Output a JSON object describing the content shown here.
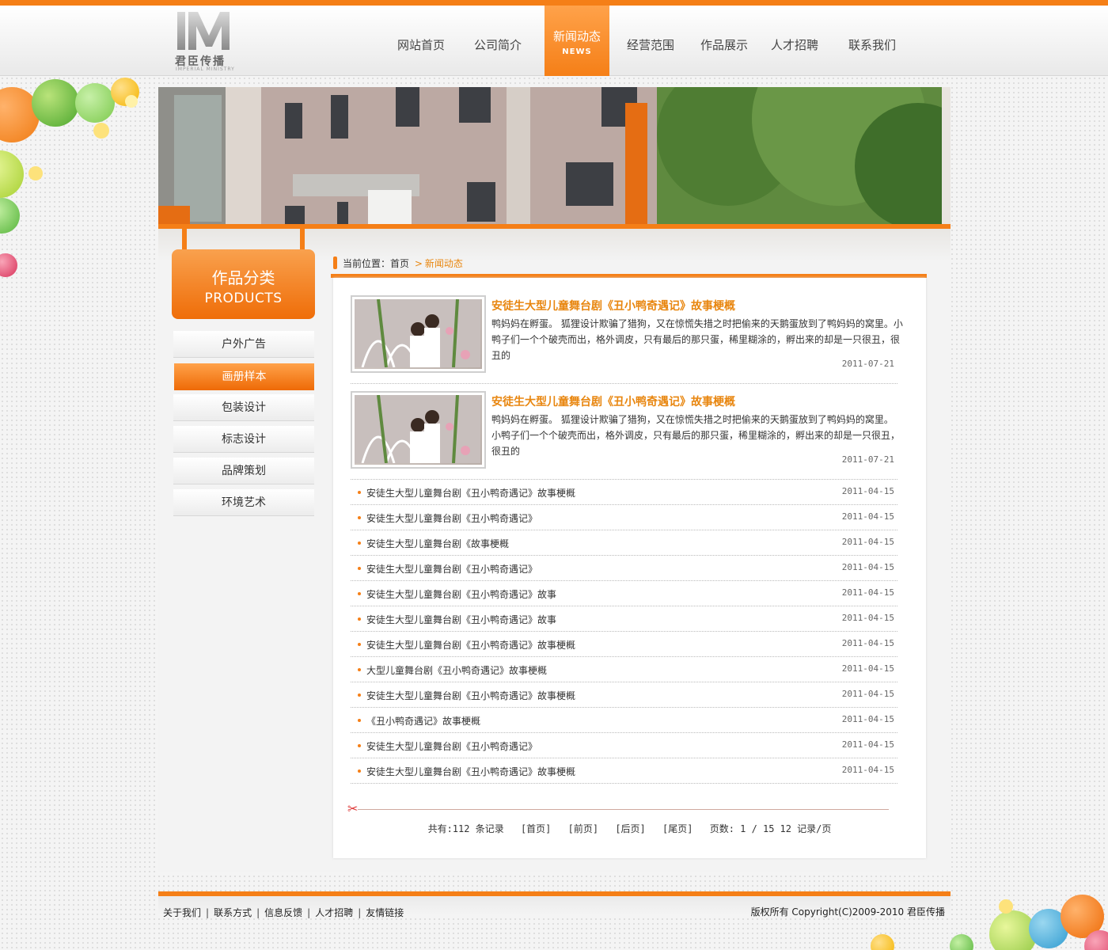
{
  "colors": {
    "accent": "#f57f17",
    "title": "#e8860f",
    "text": "#333333"
  },
  "logo": {
    "monogram": "IM",
    "name": "君臣传播",
    "sub": "IMPERIAL MINISTRY"
  },
  "nav": [
    {
      "label": "网站首页"
    },
    {
      "label": "公司简介"
    },
    {
      "label": "新闻动态",
      "sub": "NEWS",
      "active": true
    },
    {
      "label": "经营范围"
    },
    {
      "label": "作品展示"
    },
    {
      "label": "人才招聘"
    },
    {
      "label": "联系我们"
    }
  ],
  "sidebar": {
    "title": "作品分类",
    "subtitle": "PRODUCTS",
    "items": [
      {
        "label": "户外广告"
      },
      {
        "label": "画册样本",
        "active": true
      },
      {
        "label": "包装设计"
      },
      {
        "label": "标志设计"
      },
      {
        "label": "品牌策划"
      },
      {
        "label": "环境艺术"
      }
    ]
  },
  "breadcrumb": {
    "prefix": "当前位置：",
    "home": "首页",
    "current": "新闻动态"
  },
  "featured": [
    {
      "title": "安徒生大型儿童舞台剧《丑小鸭奇遇记》故事梗概",
      "desc": "鸭妈妈在孵蛋。 狐狸设计欺骗了猎狗，又在惊慌失措之时把偷来的天鹅蛋放到了鸭妈妈的窝里。小鸭子们一个个破壳而出，格外调皮，只有最后的那只蛋，稀里糊涂的，孵出来的却是一只很丑，很丑的",
      "date": "2011-07-21"
    },
    {
      "title": "安徒生大型儿童舞台剧《丑小鸭奇遇记》故事梗概",
      "desc": "鸭妈妈在孵蛋。 狐狸设计欺骗了猎狗，又在惊慌失措之时把偷来的天鹅蛋放到了鸭妈妈的窝里。 小鸭子们一个个破壳而出，格外调皮，只有最后的那只蛋，稀里糊涂的，孵出来的却是一只很丑，很丑的",
      "date": "2011-07-21"
    }
  ],
  "news_list": [
    {
      "title": "安徒生大型儿童舞台剧《丑小鸭奇遇记》故事梗概",
      "date": "2011-04-15"
    },
    {
      "title": "安徒生大型儿童舞台剧《丑小鸭奇遇记》",
      "date": "2011-04-15"
    },
    {
      "title": "安徒生大型儿童舞台剧《故事梗概",
      "date": "2011-04-15"
    },
    {
      "title": "安徒生大型儿童舞台剧《丑小鸭奇遇记》",
      "date": "2011-04-15"
    },
    {
      "title": "安徒生大型儿童舞台剧《丑小鸭奇遇记》故事",
      "date": "2011-04-15"
    },
    {
      "title": "安徒生大型儿童舞台剧《丑小鸭奇遇记》故事",
      "date": "2011-04-15"
    },
    {
      "title": "安徒生大型儿童舞台剧《丑小鸭奇遇记》故事梗概",
      "date": "2011-04-15"
    },
    {
      "title": "大型儿童舞台剧《丑小鸭奇遇记》故事梗概",
      "date": "2011-04-15"
    },
    {
      "title": "安徒生大型儿童舞台剧《丑小鸭奇遇记》故事梗概",
      "date": "2011-04-15"
    },
    {
      "title": "《丑小鸭奇遇记》故事梗概",
      "date": "2011-04-15"
    },
    {
      "title": "安徒生大型儿童舞台剧《丑小鸭奇遇记》",
      "date": "2011-04-15"
    },
    {
      "title": "安徒生大型儿童舞台剧《丑小鸭奇遇记》故事梗概",
      "date": "2011-04-15"
    }
  ],
  "pager": {
    "total": "共有:112 条记录",
    "first": "[首页]",
    "prev": "[前页]",
    "next": "[后页]",
    "last": "[尾页]",
    "pages": "页数: 1 / 15",
    "per_page": "12 记录/页"
  },
  "footer": {
    "links": [
      "关于我们",
      "联系方式",
      "信息反馈",
      "人才招聘",
      "友情链接"
    ],
    "separator": "|",
    "copyright": "版权所有 Copyright(C)2009-2010 君臣传播"
  }
}
